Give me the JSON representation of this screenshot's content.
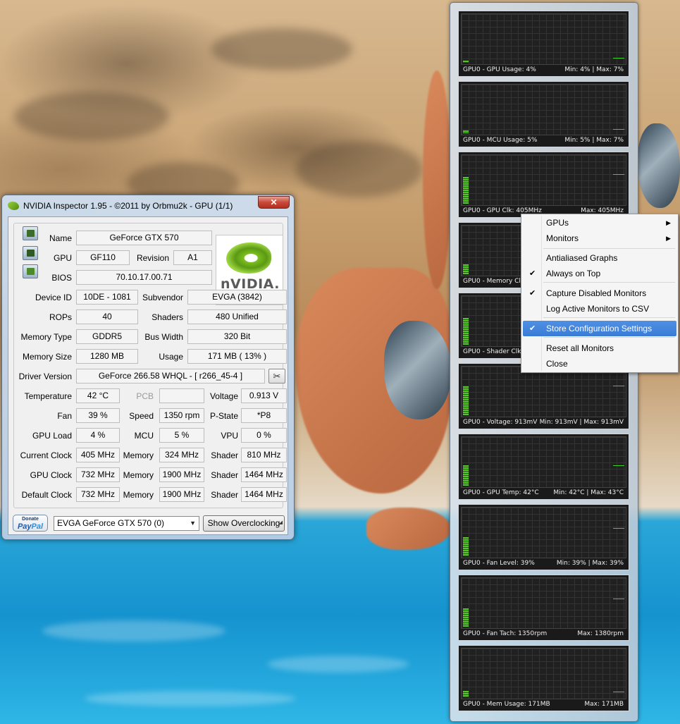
{
  "inspector": {
    "title": "NVIDIA Inspector 1.95 - ©2011 by Orbmu2k - GPU (1/1)",
    "close_glyph": "✕",
    "logo_text": "nVIDIA.",
    "fields": {
      "name_label": "Name",
      "name": "GeForce GTX 570",
      "gpu_label": "GPU",
      "gpu": "GF110",
      "revision_label": "Revision",
      "revision": "A1",
      "bios_label": "BIOS",
      "bios": "70.10.17.00.71",
      "device_id_label": "Device ID",
      "device_id": "10DE - 1081",
      "subvendor_label": "Subvendor",
      "subvendor": "EVGA (3842)",
      "rops_label": "ROPs",
      "rops": "40",
      "shaders_label": "Shaders",
      "shaders": "480 Unified",
      "memory_type_label": "Memory Type",
      "memory_type": "GDDR5",
      "bus_width_label": "Bus Width",
      "bus_width": "320 Bit",
      "memory_size_label": "Memory Size",
      "memory_size": "1280 MB",
      "usage_label": "Usage",
      "usage": "171 MB ( 13% )",
      "driver_version_label": "Driver Version",
      "driver_version": "GeForce 266.58 WHQL - [ r266_45-4 ]",
      "temperature_label": "Temperature",
      "temperature": "42 °C",
      "pcb_label": "PCB",
      "pcb": "",
      "voltage_label": "Voltage",
      "voltage": "0.913 V",
      "fan_label": "Fan",
      "fan": "39 %",
      "speed_label": "Speed",
      "speed": "1350 rpm",
      "pstate_label": "P-State",
      "pstate": "*P8",
      "gpu_load_label": "GPU Load",
      "gpu_load": "4 %",
      "mcu_label": "MCU",
      "mcu": "5 %",
      "vpu_label": "VPU",
      "vpu": "0 %",
      "current_clock_label": "Current Clock",
      "current_clock": "405 MHz",
      "current_memory_label": "Memory",
      "current_memory": "324 MHz",
      "current_shader_label": "Shader",
      "current_shader": "810 MHz",
      "gpu_clock_label": "GPU Clock",
      "gpu_clock": "732 MHz",
      "gpu_memory_label": "Memory",
      "gpu_memory": "1900 MHz",
      "gpu_shader_label": "Shader",
      "gpu_shader": "1464 MHz",
      "default_clock_label": "Default Clock",
      "default_clock": "732 MHz",
      "default_memory_label": "Memory",
      "default_memory": "1900 MHz",
      "default_shader_label": "Shader",
      "default_shader": "1464 MHz"
    },
    "paypal_donate": "Donate",
    "paypal_pay": "Pay",
    "paypal_pal": "Pal",
    "gpu_select": "EVGA GeForce GTX 570 (0)",
    "show_overclocking": "Show Overclocking"
  },
  "monitors": [
    {
      "left": "GPU0 - GPU Usage: 4%",
      "right": "Min: 4% | Max: 7%",
      "level": 0.05,
      "line": 0.12
    },
    {
      "left": "GPU0 - MCU Usage: 5%",
      "right": "Min: 5% | Max: 7%",
      "level": 0.06,
      "line": 0.1
    },
    {
      "left": "GPU0 - GPU Clk: 405MHz",
      "right": "Max: 405MHz",
      "level": 0.55,
      "line": 0.62
    },
    {
      "left": "GPU0 - Memory Clk",
      "right": "",
      "level": 0.2,
      "line": 0.5
    },
    {
      "left": "GPU0 - Shader Clk",
      "right": "",
      "level": 0.55,
      "line": 0.6
    },
    {
      "left": "GPU0 - Voltage: 913mV",
      "right": "Min: 913mV | Max: 913mV",
      "level": 0.6,
      "line": 0.62
    },
    {
      "left": "GPU0 - GPU Temp: 42°C",
      "right": "Min: 42°C | Max: 43°C",
      "level": 0.42,
      "line": 0.44
    },
    {
      "left": "GPU0 - Fan Level: 39%",
      "right": "Min: 39% | Max: 39%",
      "level": 0.39,
      "line": 0.6
    },
    {
      "left": "GPU0 - Fan Tach: 1350rpm",
      "right": "Max: 1380rpm",
      "level": 0.38,
      "line": 0.6
    },
    {
      "left": "GPU0 - Mem Usage: 171MB",
      "right": "Max: 171MB",
      "level": 0.13,
      "line": 0.13
    }
  ],
  "context_menu": {
    "items": [
      {
        "label": "GPUs",
        "submenu": true,
        "checked": false,
        "highlighted": false
      },
      {
        "label": "Monitors",
        "submenu": true,
        "checked": false,
        "highlighted": false
      },
      {
        "label": "Antialiased Graphs",
        "submenu": false,
        "checked": false,
        "highlighted": false
      },
      {
        "label": "Always on Top",
        "submenu": false,
        "checked": true,
        "highlighted": false
      },
      {
        "label": "Capture Disabled Monitors",
        "submenu": false,
        "checked": true,
        "highlighted": false
      },
      {
        "label": "Log Active Monitors to CSV",
        "submenu": false,
        "checked": false,
        "highlighted": false
      },
      {
        "label": "Store Configuration Settings",
        "submenu": false,
        "checked": true,
        "highlighted": true
      },
      {
        "label": "Reset all Monitors",
        "submenu": false,
        "checked": false,
        "highlighted": false
      },
      {
        "label": "Close",
        "submenu": false,
        "checked": false,
        "highlighted": false
      }
    ],
    "check_glyph": "✔",
    "submenu_glyph": "▶"
  },
  "colors": {
    "graph_green": "#55c52b",
    "menu_highlight": "#3a7bd5",
    "nvidia_green": "#76b900"
  }
}
